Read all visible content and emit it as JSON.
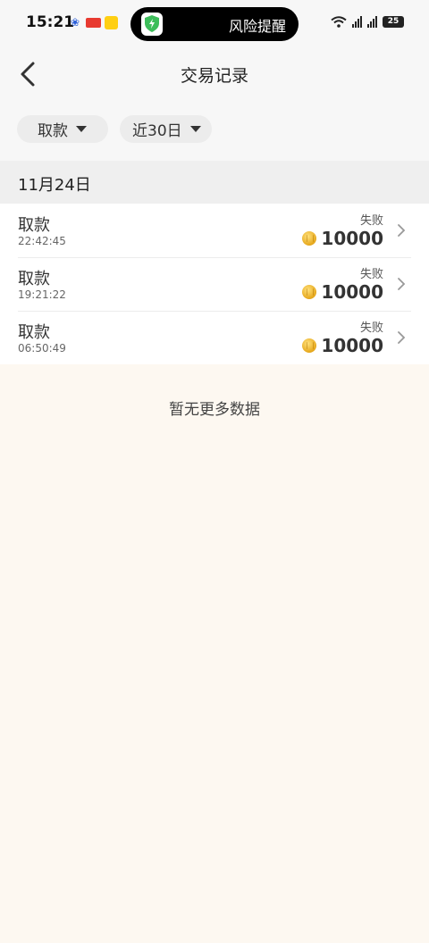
{
  "status_bar": {
    "time": "15:21",
    "apps": [
      "baidu-icon",
      "toutiao-icon",
      "meituan-icon"
    ],
    "toutiao_label": "头条",
    "meituan_label": "美团",
    "risk_alert": "风险提醒",
    "network1": "4G",
    "network2": "4G",
    "battery": "25"
  },
  "header": {
    "title": "交易记录"
  },
  "filters": {
    "type": "取款",
    "range": "近30日"
  },
  "date_group": "11月24日",
  "records": [
    {
      "type": "取款",
      "time": "22:42:45",
      "status": "失败",
      "amount": "10000"
    },
    {
      "type": "取款",
      "time": "19:21:22",
      "status": "失败",
      "amount": "10000"
    },
    {
      "type": "取款",
      "time": "06:50:49",
      "status": "失败",
      "amount": "10000"
    }
  ],
  "footer_text": "暂无更多数据",
  "colors": {
    "page_bg": "#fdf8f1",
    "header_bg": "#f7f7f7",
    "coin": "#e6a81c",
    "shield": "#3dbd5a"
  }
}
